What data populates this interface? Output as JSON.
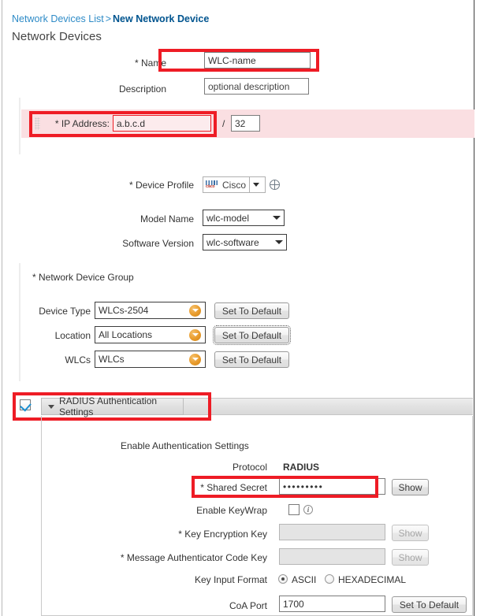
{
  "breadcrumb": {
    "parent": "Network Devices List",
    "separator": ">",
    "current": "New Network Device"
  },
  "page_title": "Network Devices",
  "colors": {
    "highlight": "#ee1c25",
    "link": "#2e8bc7",
    "current_crumb": "#00548f",
    "error_band": "#fadfe2",
    "accent_orange": "#e89a2a"
  },
  "form": {
    "name": {
      "label": "* Name",
      "value": "WLC-name",
      "highlighted": true
    },
    "description": {
      "label": "Description",
      "value": "optional description"
    },
    "ip_address": {
      "label": "* IP Address:",
      "value": "a.b.c.d",
      "slash": "/",
      "mask": "32",
      "highlighted": true
    },
    "device_profile": {
      "label": "* Device Profile",
      "value": "Cisco",
      "icon": "cisco-logo-icon",
      "add_icon": "plus-circle-icon"
    },
    "model_name": {
      "label": "Model Name",
      "value": "wlc-model"
    },
    "software_version": {
      "label": "Software Version",
      "value": "wlc-software"
    }
  },
  "network_device_group": {
    "title": "* Network Device Group",
    "rows": [
      {
        "label": "Device Type",
        "value": "WLCs-2504",
        "button": "Set To Default",
        "focused": false
      },
      {
        "label": "Location",
        "value": "All Locations",
        "button": "Set To Default",
        "focused": true
      },
      {
        "label": "WLCs",
        "value": "WLCs",
        "button": "Set To Default",
        "focused": false
      }
    ]
  },
  "radius_section": {
    "checkbox_checked": true,
    "title": "RADIUS Authentication Settings",
    "highlighted": true,
    "subheading": "Enable Authentication Settings",
    "protocol": {
      "label": "Protocol",
      "value": "RADIUS"
    },
    "shared_secret": {
      "label": "* Shared Secret",
      "value": "•••••••••",
      "button": "Show",
      "highlighted": true
    },
    "enable_keywrap": {
      "label": "Enable KeyWrap",
      "checked": false,
      "info_icon": "info-icon",
      "info_glyph": "i"
    },
    "key_encryption_key": {
      "label": "* Key Encryption Key",
      "value": "",
      "button": "Show",
      "disabled": true
    },
    "message_authenticator_code_key": {
      "label": "* Message Authenticator Code Key",
      "value": "",
      "button": "Show",
      "disabled": true
    },
    "key_input_format": {
      "label": "Key Input Format",
      "options": [
        "ASCII",
        "HEXADECIMAL"
      ],
      "selected": "ASCII"
    },
    "coa_port": {
      "label": "CoA Port",
      "value": "1700",
      "button": "Set To Default"
    }
  }
}
